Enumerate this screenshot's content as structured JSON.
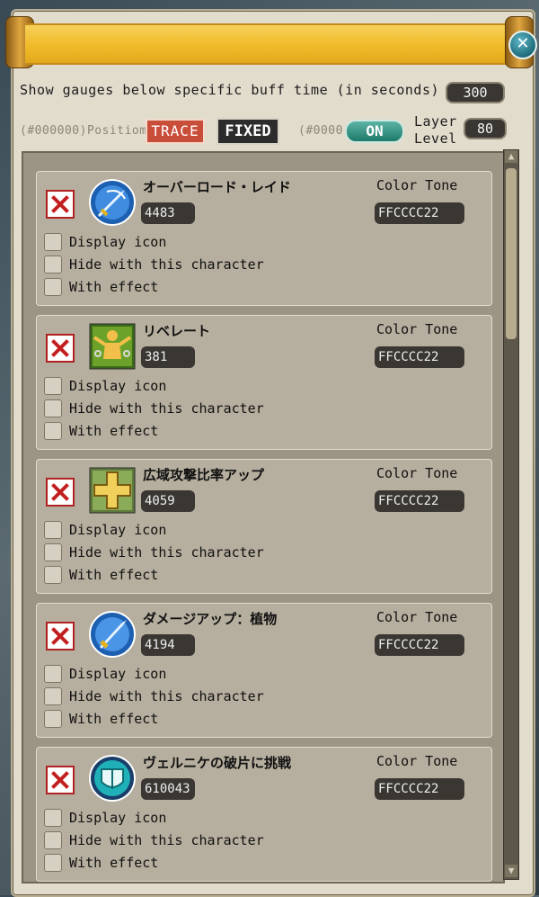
{
  "header": {
    "close_glyph": "✕",
    "gauge_time_label": "Show gauges below specific buff time (in seconds)",
    "gauge_time_value": "300",
    "position_hint": "(#000000)Positiom",
    "trace_label": "TRACE",
    "fixed_label": "FIXED",
    "on_hint": "(#0000",
    "on_label": "ON",
    "layer_label_line1": "Layer",
    "layer_label_line2": "Level",
    "layer_value": "80"
  },
  "buffs": [
    {
      "name": "オーバーロード・レイド",
      "value": "4483",
      "tone_label": "Color Tone",
      "tone": "FFCCCC22",
      "icon": "sword-slash-icon",
      "options": [
        "Display icon",
        "Hide with this character",
        "With effect"
      ]
    },
    {
      "name": "リベレート",
      "value": "381",
      "tone_label": "Color Tone",
      "tone": "FFCCCC22",
      "icon": "chain-break-icon",
      "options": [
        "Display icon",
        "Hide with this character",
        "With effect"
      ]
    },
    {
      "name": "広域攻撃比率アップ",
      "value": "4059",
      "tone_label": "Color Tone",
      "tone": "FFCCCC22",
      "icon": "cross-shield-icon",
      "options": [
        "Display icon",
        "Hide with this character",
        "With effect"
      ]
    },
    {
      "name": "ダメージアップ：植物",
      "value": "4194",
      "tone_label": "Color Tone",
      "tone": "FFCCCC22",
      "icon": "sword-icon",
      "options": [
        "Display icon",
        "Hide with this character",
        "With effect"
      ]
    },
    {
      "name": "ヴェルニケの破片に挑戦",
      "value": "610043",
      "tone_label": "Color Tone",
      "tone": "FFCCCC22",
      "icon": "shield-icon",
      "options": [
        "Display icon",
        "Hide with this character",
        "With effect"
      ]
    }
  ]
}
